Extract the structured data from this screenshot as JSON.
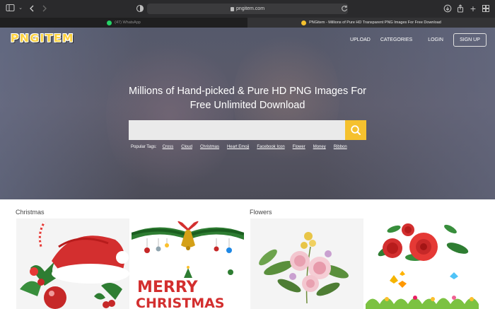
{
  "browser": {
    "url": "pngitem.com",
    "tabs": [
      {
        "label": "(47) WhatsApp",
        "active": false
      },
      {
        "label": "PNGitem - Millions of Pure HD Transparent PNG Images For Free Download",
        "active": true
      }
    ]
  },
  "site": {
    "logo_text": "PNGITEM",
    "nav": {
      "upload": "UPLOAD",
      "categories": "CATEGORIES",
      "login": "LOGIN",
      "signup": "SIGN UP"
    },
    "headline_line1": "Millions of Hand-picked & Pure HD PNG Images For",
    "headline_line2": "Free Unlimited Download",
    "search": {
      "placeholder": "",
      "value": ""
    },
    "popular_tags_label": "Popular Tags:",
    "popular_tags": [
      "Cross",
      "Cloud",
      "Christmas",
      "Heart Emoji",
      "Facebook Icon",
      "Flower",
      "Money",
      "Ribbon"
    ]
  },
  "sections": [
    {
      "title": "Christmas"
    },
    {
      "title": "Flowers"
    }
  ],
  "thumbnails": {
    "merry_christmas_line1": "MERRY",
    "merry_christmas_line2": "CHRISTMAS"
  },
  "colors": {
    "accent": "#f5c12e",
    "logo": "#ffd23f"
  }
}
